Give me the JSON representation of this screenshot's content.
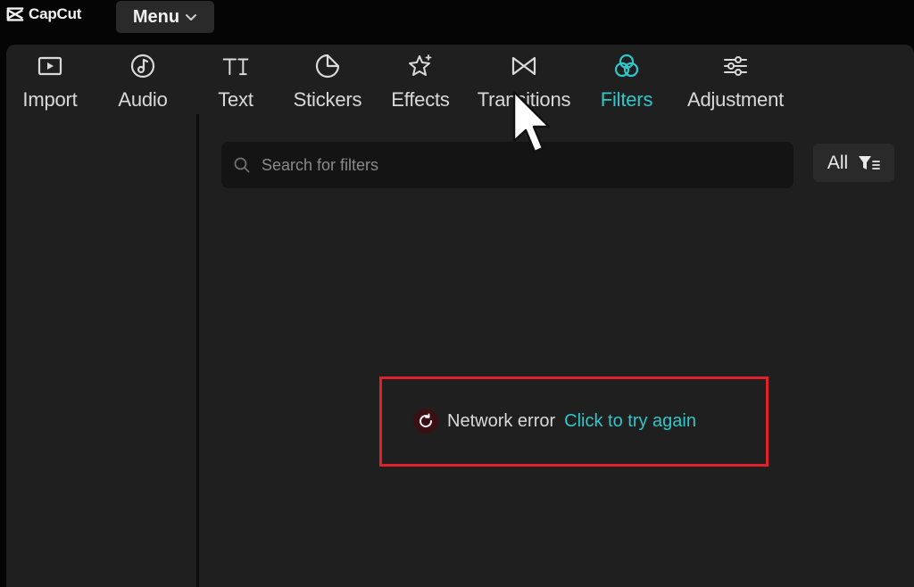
{
  "app": {
    "name": "CapCut"
  },
  "menu": {
    "label": "Menu"
  },
  "toolbar": {
    "items": [
      {
        "label": "Import",
        "icon": "import-icon"
      },
      {
        "label": "Audio",
        "icon": "audio-icon"
      },
      {
        "label": "Text",
        "icon": "text-icon"
      },
      {
        "label": "Stickers",
        "icon": "sticker-icon"
      },
      {
        "label": "Effects",
        "icon": "effects-icon"
      },
      {
        "label": "Transitions",
        "icon": "transitions-icon"
      },
      {
        "label": "Filters",
        "icon": "filters-icon",
        "active": true
      },
      {
        "label": "Adjustment",
        "icon": "adjustment-icon"
      }
    ]
  },
  "search": {
    "placeholder": "Search for filters"
  },
  "filter": {
    "label": "All"
  },
  "error": {
    "message": "Network error",
    "action": "Click to try again"
  },
  "colors": {
    "accent": "#2fc7c9",
    "error_ring": "#e0202a",
    "background": "#1f1f1f"
  }
}
